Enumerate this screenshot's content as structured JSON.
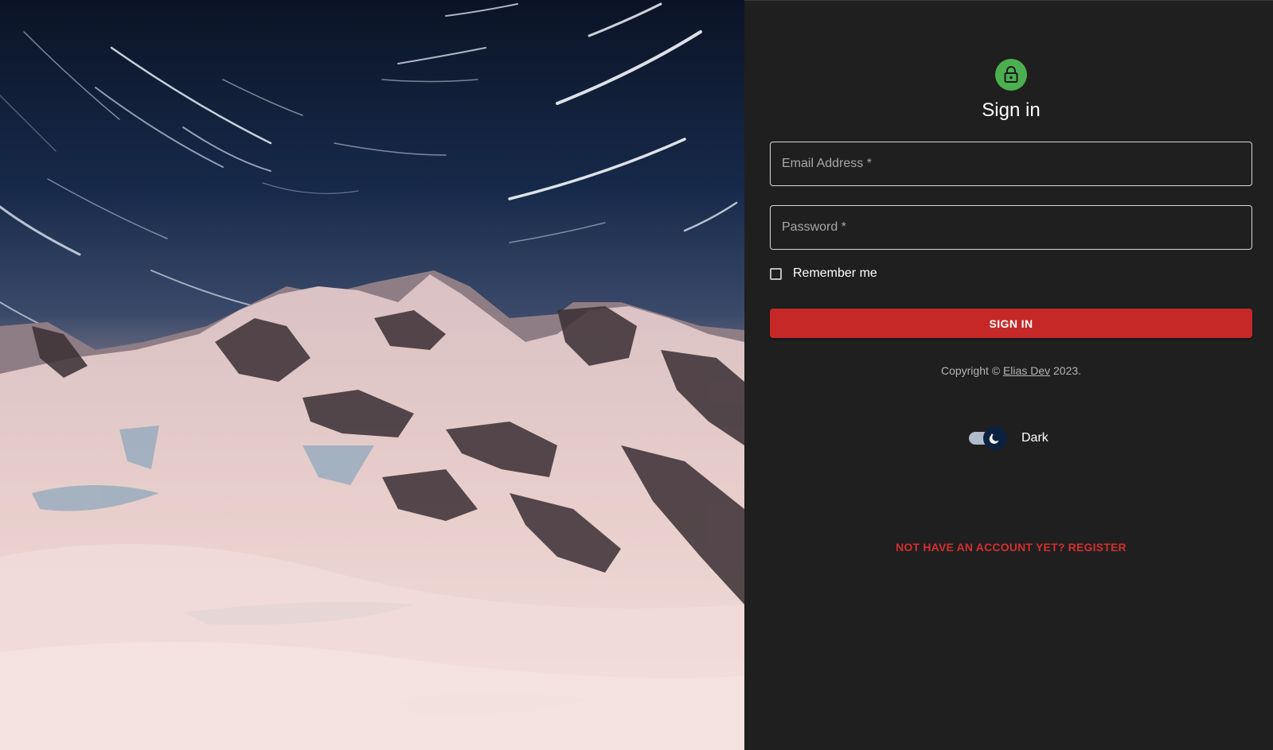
{
  "hero": {
    "image_description_icon": "mountain-star-trails-photo"
  },
  "form": {
    "avatar_icon": "lock-icon",
    "title": "Sign in",
    "email_placeholder": "Email Address *",
    "email_value": "",
    "password_placeholder": "Password *",
    "password_value": "",
    "remember_label": "Remember me",
    "remember_checked": false,
    "submit_label": "SIGN IN"
  },
  "footer": {
    "copyright_prefix": "Copyright © ",
    "copyright_link": "Elias Dev",
    "copyright_suffix": " 2023."
  },
  "theme": {
    "toggle_icon": "moon-icon",
    "label": "Dark",
    "enabled": true
  },
  "register": {
    "label": "NOT HAVE AN ACCOUNT YET? REGISTER"
  },
  "colors": {
    "panel_bg": "#1f1f1f",
    "accent_red": "#c62828",
    "avatar_green": "#4caf50",
    "toggle_thumb": "#0c2140"
  }
}
